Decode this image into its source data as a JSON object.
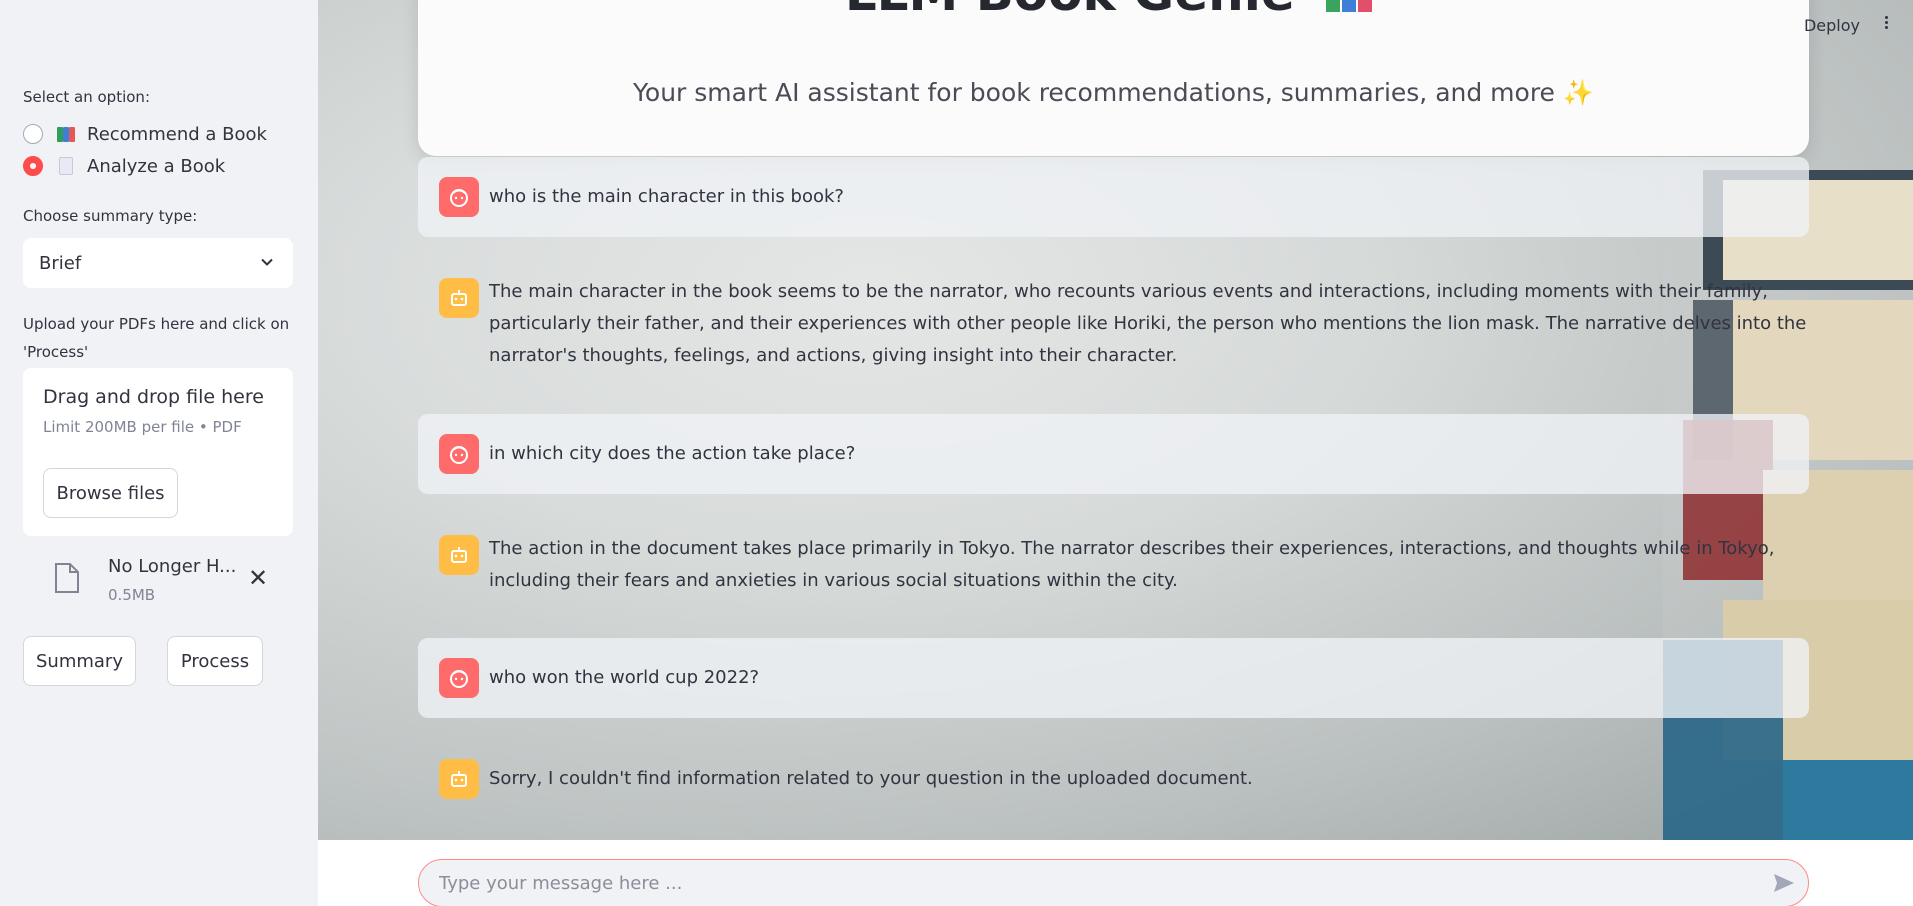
{
  "sidebar": {
    "option_label": "Select an option:",
    "options": [
      {
        "label": "Recommend a Book",
        "selected": false
      },
      {
        "label": "Analyze a Book",
        "selected": true
      }
    ],
    "summary_type_label": "Choose summary type:",
    "summary_type_value": "Brief",
    "upload_label": "Upload your PDFs here and click on 'Process'",
    "dropzone_title": "Drag and drop file here",
    "dropzone_limit": "Limit 200MB per file • PDF",
    "browse_label": "Browse files",
    "file": {
      "name": "No Longer H...",
      "size": "0.5MB"
    },
    "summary_button": "Summary",
    "process_button": "Process"
  },
  "header": {
    "title": "LLM Book Genie",
    "subtitle": "Your smart AI assistant for book recommendations, summaries, and more ✨"
  },
  "toolbar": {
    "deploy": "Deploy"
  },
  "messages": [
    {
      "role": "user",
      "text": "who is the main character in this book?"
    },
    {
      "role": "assistant",
      "text": "The main character in the book seems to be the narrator, who recounts various events and interactions, including moments with their family, particularly their father, and their experiences with other people like Horiki, the person who mentions the lion mask. The narrative delves into the narrator's thoughts, feelings, and actions, giving insight into their character."
    },
    {
      "role": "user",
      "text": "in which city does the action take place?"
    },
    {
      "role": "assistant",
      "text": "The action in the document takes place primarily in Tokyo. The narrator describes their experiences, interactions, and thoughts while in Tokyo, including their fears and anxieties in various social situations within the city."
    },
    {
      "role": "user",
      "text": "who won the world cup 2022?"
    },
    {
      "role": "assistant",
      "text": "Sorry, I couldn't find information related to your question in the uploaded document."
    }
  ],
  "chat_input": {
    "placeholder": "Type your message here ..."
  },
  "colors": {
    "accent": "#ff4b4b",
    "user_avatar": "#ff6b6b",
    "assistant_avatar": "#ffbd45"
  }
}
